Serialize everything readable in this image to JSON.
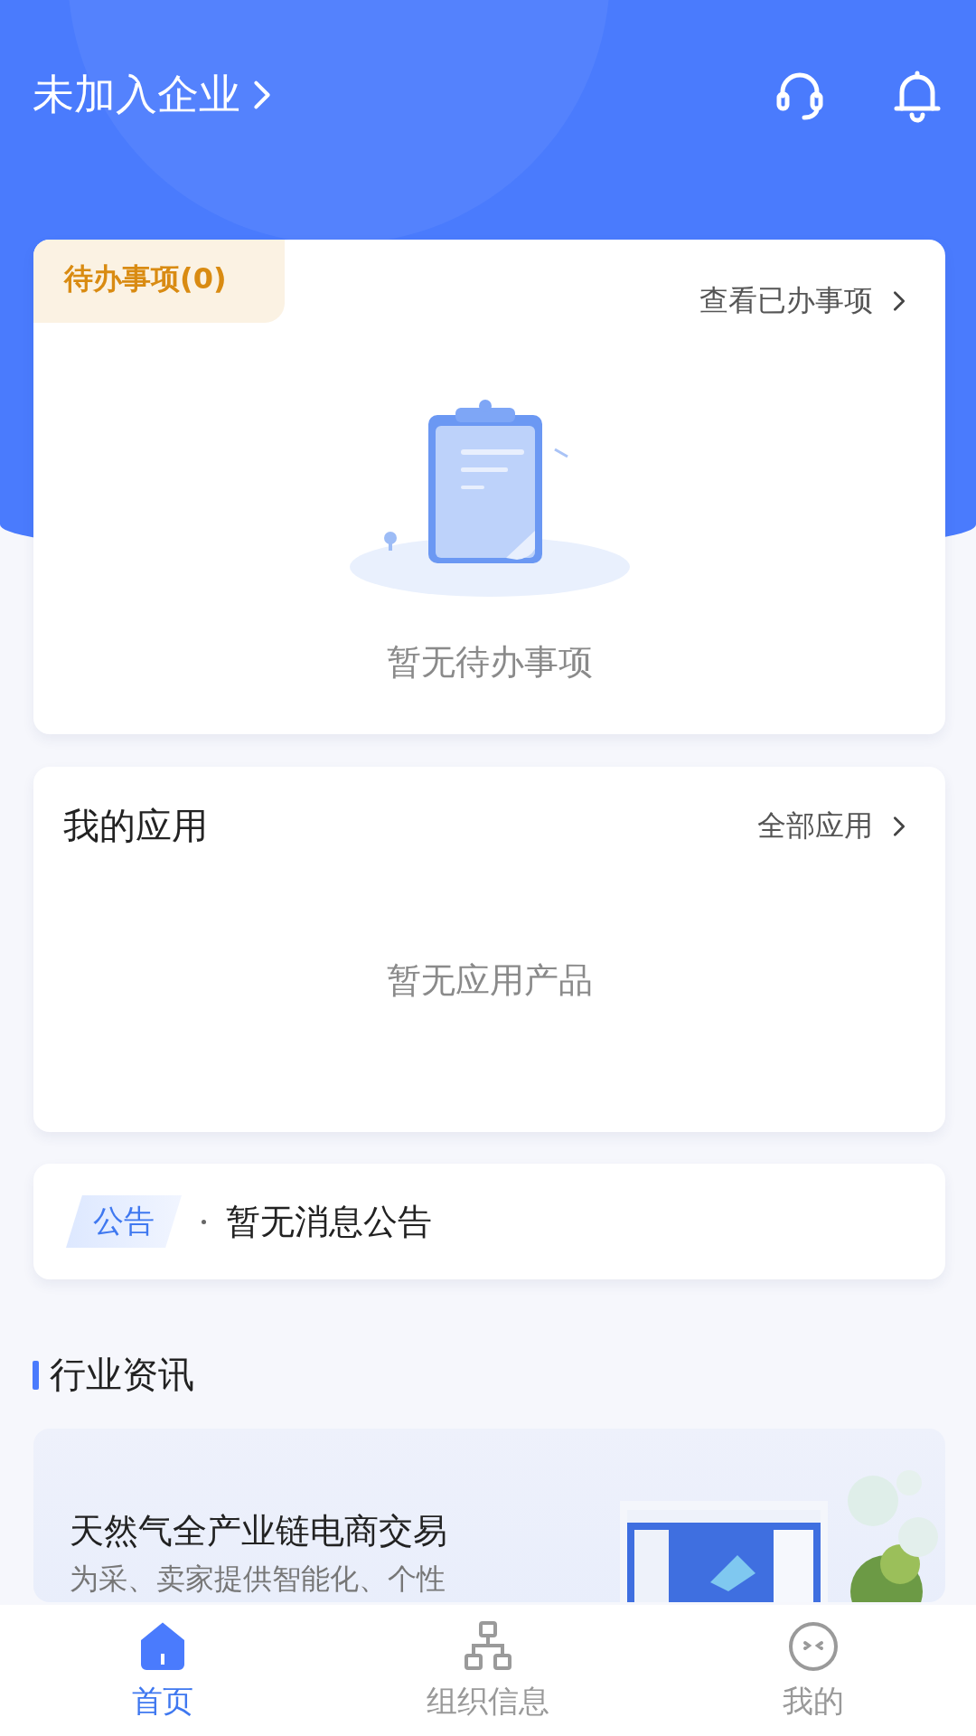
{
  "header": {
    "title": "未加入企业"
  },
  "todo": {
    "tab": "待办事项(0)",
    "link": "查看已办事项",
    "empty_text": "暂无待办事项"
  },
  "apps": {
    "title": "我的应用",
    "link": "全部应用",
    "empty_text": "暂无应用产品"
  },
  "notice": {
    "tag": "公告",
    "text": "暂无消息公告"
  },
  "news": {
    "title": "行业资讯",
    "items": [
      {
        "title": "天然气全产业链电商交易",
        "summary": "为采、卖家提供智能化、个性"
      }
    ]
  },
  "tabbar": [
    {
      "label": "首页",
      "kind": "home",
      "selected": true
    },
    {
      "label": "组织信息",
      "kind": "org",
      "selected": false
    },
    {
      "label": "我的",
      "kind": "face",
      "selected": false
    }
  ]
}
